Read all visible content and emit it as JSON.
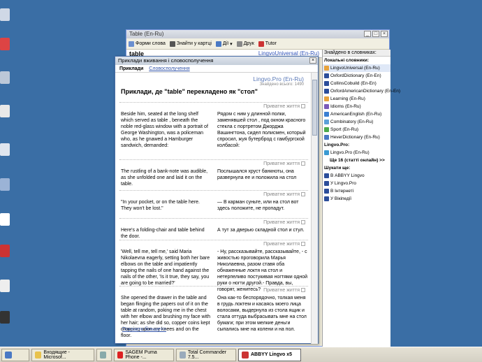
{
  "main_window": {
    "title": "Table (En-Ru)",
    "toolbar": {
      "forms": "Форми слова",
      "find_card": "Знайти у картці",
      "dropdown": "Дії",
      "print": "Друк",
      "tutor": "Tutor"
    },
    "search_query": "table",
    "current_dictionary": "LingvoUniversal (En-Ru)"
  },
  "right_pane": {
    "header": "Знайдено в словниках:",
    "section_local": "Локальні словники:",
    "local_dicts": [
      "LingvoUniversal (En-Ru)",
      "OxfordDictionary (En-En)",
      "CollinsCobuild (En-En)",
      "OxfordAmericanDictionary (En-En)",
      "Learning (En-Ru)",
      "Idioms (En-Ru)",
      "AmericanEnglish (En-Ru)",
      "Combinatory (En-Ru)",
      "Sport (En-Ru)",
      "HeverDictionary (En-Ru)"
    ],
    "section_pro": "Lingvo.Pro:",
    "pro_items": [
      "Lingvo.Pro (En-Ru)"
    ],
    "more_articles": "Ще 16 (статті онлайн) >>",
    "section_search": "Шукати ще:",
    "search_more": [
      "В ABBYY Lingvo",
      "У Lingvo.Pro",
      "В Інтернеті",
      "У Вікіпедії"
    ]
  },
  "examples_window": {
    "title": "Приклади вживання і словосполучення",
    "tabs": [
      "Приклади",
      "Словосполучення"
    ],
    "source": "Lingvo.Pro (En-Ru)",
    "count": "Знайдено всього: 1490",
    "heading": "Приклади, де \"table\" перекладено як \"стол\"",
    "entries": [
      {
        "note": "Приватне життя",
        "en": "Beside him, seated at the long shelf which served as table , beneath the noble red-glass window with a portrait of George Washington, was a policeman who, as he gnawed a Hamburger sandwich, demanded:",
        "ru": "Рядом с ним у длинной полки, заменявшей стол , под окном красного стекла с портретом Джорджа Вашингтона, сидел полисмен, который спросил, жуя бутерброд с гамбургской колбасой:"
      },
      {
        "note": "Приватне життя",
        "en": "The rustling of a bank-note was audible, as she unfolded one and laid it on the table.",
        "ru": "Послышался хруст банкноты, она развернула ее и положила на стол"
      },
      {
        "note": "Приватне життя",
        "en": "\"In your pocket, or on the table here. They won't be lost.\"",
        "ru": "— В карман суньте, или на стол вот здесь положите, не пропадут."
      },
      {
        "note": "Приватне життя",
        "en": "Here's a folding-chair and table behind the door.",
        "ru": "А тут за дверью складной стол и стул."
      },
      {
        "note": "Приватне життя",
        "en": "'Well, tell me, tell me,' said Maria Nikolaevna eagerly, setting both her bare elbows on the table and impatiently tapping the nails of one hand against the nails of the other, 'Is it true, they say, you are going to be married?'",
        "ru": "- Ну, рассказывайте, рассказывайте, - с живостью проговорила Марья Николаевна, разом ставя оба обнаженные локтя на стол и нетерпеливо постукивая ногтями одной руки о ногти другой.- Правда, вы, говорят, женитесь?"
      },
      {
        "note": "Приватне життя",
        "en": "She opened the drawer in the table and began flinging the papers out of it on the table at random, poking me in the chest with her elbow and brushing my face with her hair; as she did so, copper coins kept dropping upon my knees and on the floor.",
        "ru": "Она как-то беспорядочно, толкая меня в грудь локтем и касаясь моего лица волосами, выдернула из стола ящик и стала оттуда выбрасывать мне на стол бумаги; при этом мелкие деньги сыпались мне на колени и на пол."
      }
    ],
    "more_link": "Показати більше>>"
  },
  "taskbar": {
    "items": [
      "Входящие - Microsof...",
      "",
      "SAGEM Puma Phone -...",
      "Total Commander 7.5...",
      "ABBYY Lingvo x5"
    ]
  },
  "colors": {
    "desktop": "#3a6ea5",
    "accent_link": "#3355aa"
  }
}
